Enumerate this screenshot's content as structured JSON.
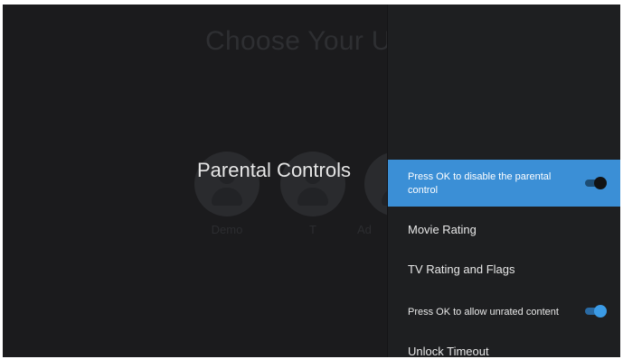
{
  "background": {
    "title": "Choose Your U",
    "avatars": [
      {
        "name": "Demo"
      },
      {
        "name": "T"
      },
      {
        "name": "Ad"
      }
    ]
  },
  "section_title": "Parental Controls",
  "panel": {
    "items": [
      {
        "label": "Press OK to disable the parental control",
        "selected": true,
        "toggle": "on"
      },
      {
        "label": "Movie Rating",
        "selected": false
      },
      {
        "label": "TV Rating and Flags",
        "selected": false
      },
      {
        "label": "Press OK to allow unrated content",
        "selected": false,
        "toggle": "on"
      },
      {
        "label": "Unlock Timeout",
        "selected": false
      }
    ]
  },
  "colors": {
    "accent": "#3b8fd6",
    "background": "#1b1b1d",
    "panel": "#1e1f21"
  }
}
